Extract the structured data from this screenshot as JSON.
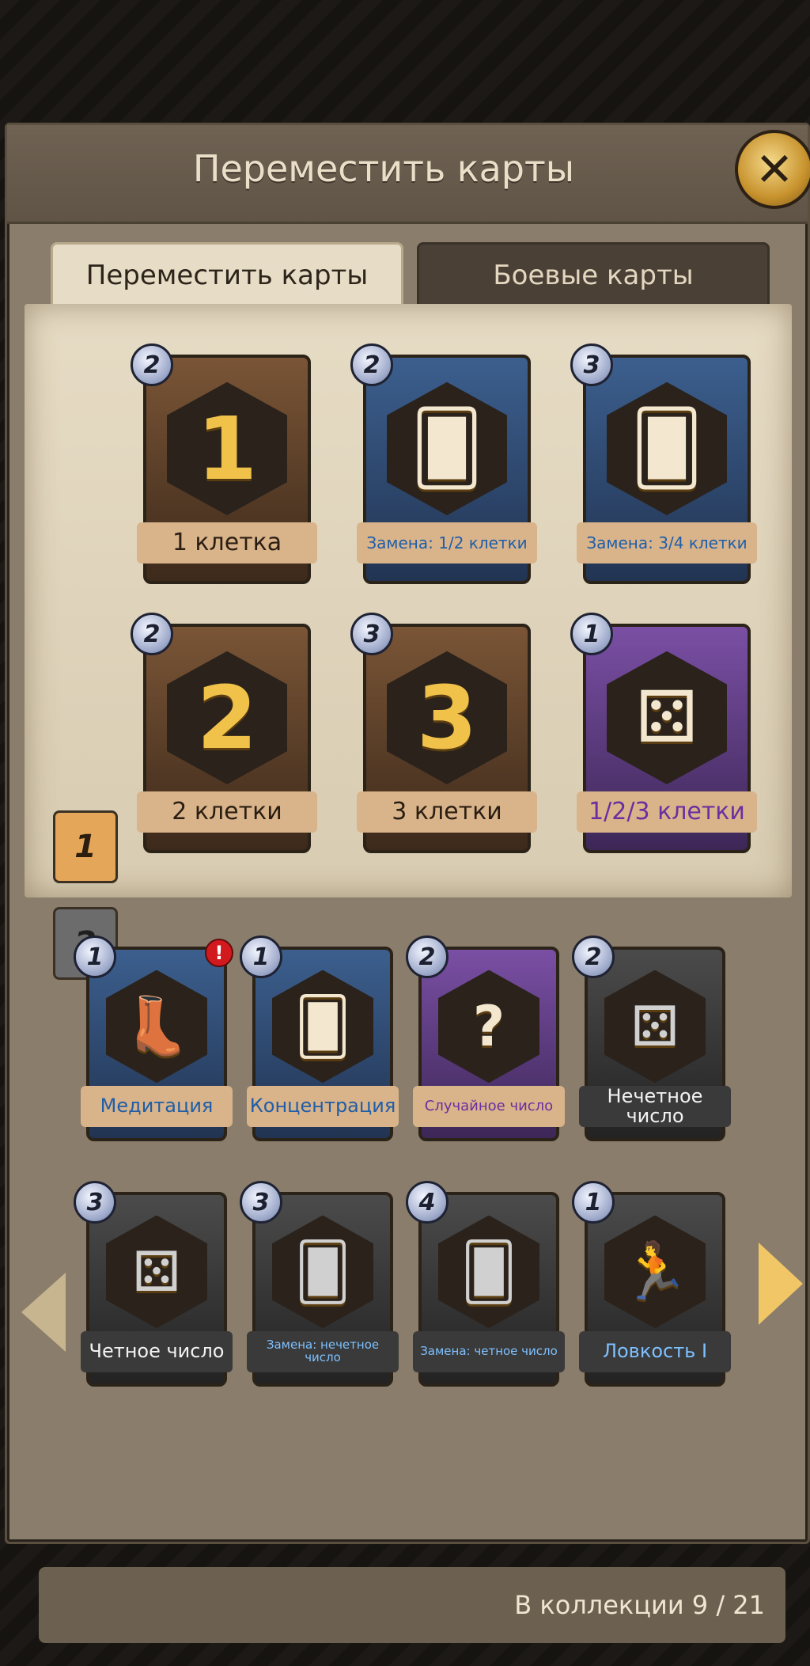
{
  "header": {
    "title": "Переместить карты",
    "close_icon": "close-icon"
  },
  "tabs": [
    {
      "label": "Переместить карты",
      "active": true
    },
    {
      "label": "Боевые карты",
      "active": false
    }
  ],
  "deck_selector": [
    {
      "label": "1",
      "active": true
    },
    {
      "label": "2",
      "active": false
    }
  ],
  "deck_cards": [
    {
      "cost": "2",
      "label": "1 клетка",
      "glyph": "1",
      "theme": "brown"
    },
    {
      "cost": "2",
      "label": "Замена: 1/2 клетки",
      "glyph": "cards-hand-icon",
      "theme": "blue"
    },
    {
      "cost": "3",
      "label": "Замена: 3/4 клетки",
      "glyph": "cards-hand-icon",
      "theme": "blue"
    },
    {
      "cost": "2",
      "label": "2 клетки",
      "glyph": "2",
      "theme": "brown"
    },
    {
      "cost": "3",
      "label": "3 клетки",
      "glyph": "3",
      "theme": "brown"
    },
    {
      "cost": "1",
      "label": "1/2/3 клетки",
      "glyph": "dice-icon",
      "theme": "purple"
    }
  ],
  "collection_cards": [
    {
      "cost": "1",
      "label": "Медитация",
      "glyph": "boots-icon",
      "theme": "blue",
      "alert": "!"
    },
    {
      "cost": "1",
      "label": "Концентрация",
      "glyph": "cards-plus-icon",
      "theme": "blue"
    },
    {
      "cost": "2",
      "label": "Случайное число",
      "glyph": "mystery-dice-icon",
      "theme": "purple"
    },
    {
      "cost": "2",
      "label": "Нечетное число",
      "glyph": "dice-icon",
      "theme": "gray"
    },
    {
      "cost": "3",
      "label": "Четное число",
      "glyph": "dice-icon",
      "theme": "gray"
    },
    {
      "cost": "3",
      "label": "Замена: нечетное число",
      "glyph": "cards-hand-icon",
      "theme": "gray"
    },
    {
      "cost": "4",
      "label": "Замена: четное число",
      "glyph": "cards-hand-icon",
      "theme": "gray"
    },
    {
      "cost": "1",
      "label": "Ловкость I",
      "glyph": "running-legs-icon",
      "theme": "gray"
    }
  ],
  "navigation": {
    "prev_icon": "arrow-left-icon",
    "next_icon": "arrow-right-icon"
  },
  "footer": {
    "collection_text": "В коллекции 9 / 21"
  }
}
